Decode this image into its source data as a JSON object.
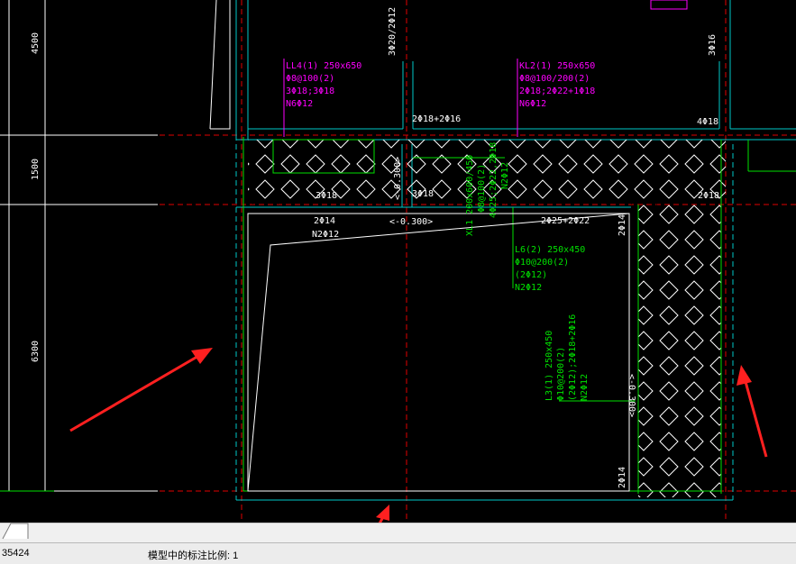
{
  "drawing": {
    "dimensions": [
      "4500",
      "1500",
      "6300"
    ],
    "beams": {
      "ll4": [
        "LL4(1) 250x650",
        "Φ8@100(2)",
        "3Φ18;3Φ18",
        "N6Φ12"
      ],
      "kl2": [
        "KL2(1) 250x650",
        "Φ8@100/200(2)",
        "2Φ18;2Φ22+1Φ18",
        "N6Φ12"
      ],
      "xl1": [
        "XL1 200x600/450",
        "Φ8@100(2)",
        "4Φ25;2Φ22,2Φ18",
        "N2Φ12"
      ],
      "l6": [
        "L6(2) 250x450",
        "Φ10@200(2)",
        "(2Φ12)",
        "N2Φ12"
      ],
      "l3": [
        "L3(1) 250x450",
        "Φ10@200(2)",
        "(2Φ12);2Φ18+2Φ16",
        "N2Φ12"
      ]
    },
    "rebar": {
      "top_3phi20": "3Φ20/2Φ12",
      "right_3phi16": "3Φ16",
      "phi18_16": "2Φ18+2Φ16",
      "phi4_18": "4Φ18",
      "bot_3phi18": "3Φ18",
      "mid_3phi18": "3Φ18",
      "right_2phi18": "2Φ18",
      "slab_2phi14": "2Φ14",
      "slab_n2phi12": "N2Φ12",
      "slab_2phi25": "2Φ25+2Φ22",
      "side_2phi14_top": "2Φ14",
      "side_2phi14_bot": "2Φ14"
    },
    "elevations": {
      "a": "<-0.300>",
      "b": "<-0.300>",
      "c": "<-0.300>"
    }
  },
  "status": {
    "coordinates": "35424",
    "scale_text": "模型中的标注比例: 1"
  },
  "colors": {
    "background": "#000000",
    "magenta": "#ff00ff",
    "green": "#00e000",
    "cyan": "#00c8c8",
    "red": "#e00000",
    "white": "#ffffff",
    "arrow": "#ff2020"
  }
}
